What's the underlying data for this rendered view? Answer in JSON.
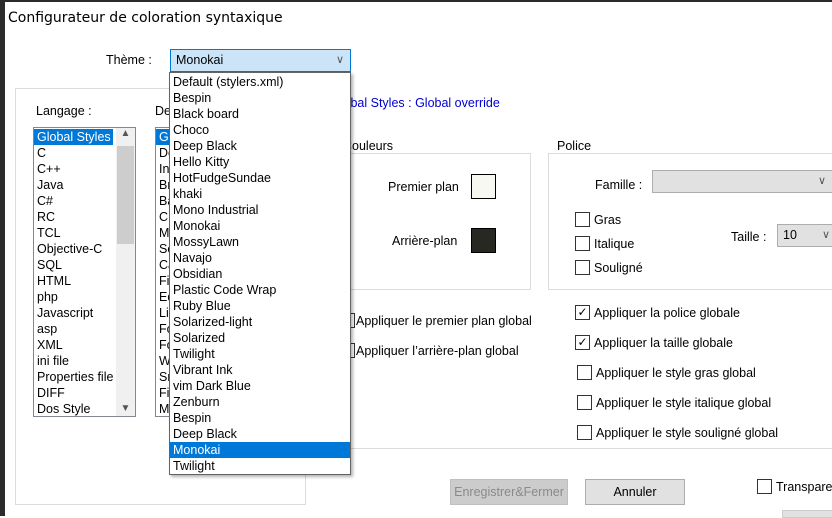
{
  "window": {
    "title": "Configurateur de coloration syntaxique"
  },
  "theme": {
    "label": "Thème :",
    "selected": "Monokai",
    "options": [
      "Default (stylers.xml)",
      "Bespin",
      "Black board",
      "Choco",
      "Deep Black",
      "Hello Kitty",
      "HotFudgeSundae",
      "khaki",
      "Mono Industrial",
      "Monokai",
      "MossyLawn",
      "Navajo",
      "Obsidian",
      "Plastic Code Wrap",
      "Ruby Blue",
      "Solarized-light",
      "Solarized",
      "Twilight",
      "Vibrant Ink",
      "vim Dark Blue",
      "Zenburn",
      "Bespin",
      "Deep Black",
      "Monokai",
      "Twilight"
    ],
    "highlighted_index": 23
  },
  "language": {
    "label": "Langage :",
    "selected": "Global Styles",
    "items": [
      "Global Styles",
      "C",
      "C++",
      "Java",
      "C#",
      "RC",
      "TCL",
      "Objective-C",
      "SQL",
      "HTML",
      "php",
      "Javascript",
      "asp",
      "XML",
      "ini file",
      "Properties file",
      "DIFF",
      "Dos Style"
    ]
  },
  "style": {
    "label_fragment": "De",
    "items_fragments": [
      "Gl",
      "De",
      "In",
      "Br",
      "Ba",
      "C",
      "M",
      "Se",
      "Ca",
      "Fi",
      "Ed",
      "Li",
      "Fo",
      "Fo",
      "W",
      "Sr",
      "Fi",
      "M"
    ]
  },
  "style_heading": "Global Styles : Global override",
  "colors": {
    "legend": "Couleurs",
    "foreground_label": "Premier plan",
    "foreground_color": "#f8f8f2",
    "background_label": "Arrière-plan",
    "background_color": "#272822"
  },
  "font": {
    "legend": "Police",
    "family_label": "Famille :",
    "family_value": "",
    "bold_label": "Gras",
    "italic_label": "Italique",
    "underline_label": "Souligné",
    "size_label": "Taille :",
    "size_value": "10"
  },
  "global_options": {
    "apply_fg": {
      "label": "Appliquer le premier plan global",
      "checked": false
    },
    "apply_bg": {
      "label": "Appliquer l’arrière-plan global",
      "checked": false
    },
    "apply_font": {
      "label": "Appliquer la police globale",
      "checked": true
    },
    "apply_size": {
      "label": "Appliquer la taille globale",
      "checked": true
    },
    "apply_bold": {
      "label": "Appliquer le style gras global",
      "checked": false
    },
    "apply_italic": {
      "label": "Appliquer le style italique global",
      "checked": false
    },
    "apply_underline": {
      "label": "Appliquer le style souligné global",
      "checked": false
    }
  },
  "buttons": {
    "save_close": "Enregistrer&Fermer",
    "cancel": "Annuler",
    "transparency": "Transpare"
  }
}
